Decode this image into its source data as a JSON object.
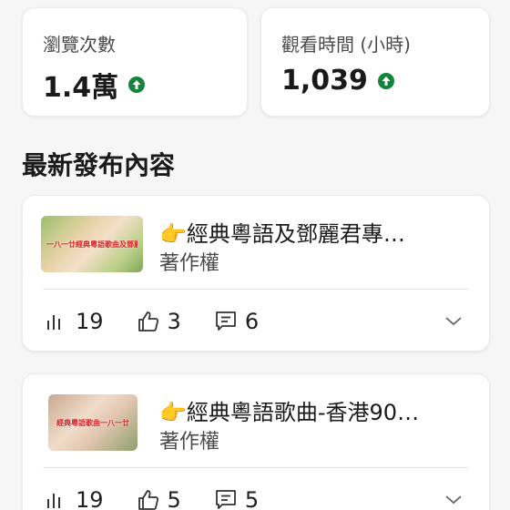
{
  "stats": [
    {
      "label": "瀏覽次數",
      "value": "1.4萬",
      "trend": "up"
    },
    {
      "label": "觀看時間 (小時)",
      "value": "1,039",
      "trend": "up"
    }
  ],
  "colors": {
    "trend_up": "#14833b",
    "background": "#f6f6f6"
  },
  "section": {
    "title": "最新發布內容"
  },
  "posts": [
    {
      "thumb_text": "一八一廿經典粵語歌曲及鄧麗君專輯",
      "title": "👉經典粵語及鄧麗君專…",
      "subtitle": "著作權",
      "views": "19",
      "likes": "3",
      "comments": "6"
    },
    {
      "thumb_text": "經典粵語歌曲一八一廿",
      "title": "👉經典粵語歌曲-香港90…",
      "subtitle": "著作權",
      "views": "19",
      "likes": "5",
      "comments": "5"
    }
  ],
  "icons": {
    "trend": "arrow-up-circle-icon",
    "views": "bar-chart-icon",
    "likes": "thumbs-up-icon",
    "comments": "comment-icon",
    "expand": "chevron-down-icon"
  }
}
